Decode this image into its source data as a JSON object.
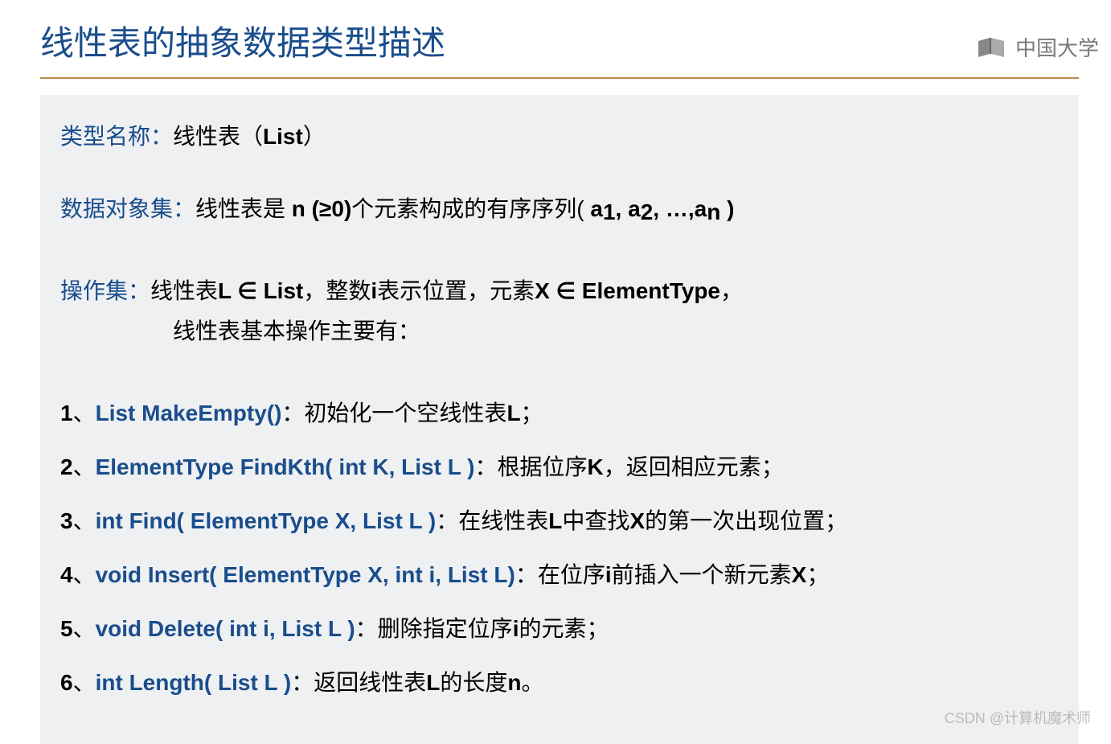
{
  "title": "线性表的抽象数据类型描述",
  "logo": {
    "text": "中国大学"
  },
  "typeName": {
    "label": "类型名称：",
    "value_prefix": "线性表（",
    "value_bold": "List",
    "value_suffix": "）"
  },
  "dataObject": {
    "label": "数据对象集：",
    "part1": "线性表是 ",
    "part2": "n (≥0)",
    "part3": "个元素构成的有序序列( ",
    "a1": "a",
    "sub1": "1",
    "comma1": ", ",
    "a2": "a",
    "sub2": "2",
    "comma2": ", …,",
    "an": "a",
    "subn": "n",
    "part4": " )"
  },
  "operationSet": {
    "label": "操作集：",
    "line1_p1": "线性表",
    "line1_p2": "L ∈ List",
    "line1_p3": "，整数",
    "line1_p4": "i",
    "line1_p5": "表示位置，元素",
    "line1_p6": "X ∈ ElementType",
    "line1_p7": "，",
    "line2": "线性表基本操作主要有："
  },
  "operations": [
    {
      "num": "1",
      "sep": "、",
      "code": "List MakeEmpty()",
      "desc_p1": "：初始化一个空线性表",
      "desc_b1": "L",
      "desc_p2": "；"
    },
    {
      "num": "2",
      "sep": "、",
      "code": "ElementType FindKth( int K, List L )",
      "desc_p1": "：根据位序",
      "desc_b1": "K",
      "desc_p2": "，返回相应元素；"
    },
    {
      "num": "3",
      "sep": "、",
      "code": "int Find( ElementType X, List L )",
      "desc_p1": "：在线性表",
      "desc_b1": "L",
      "desc_p2": "中查找",
      "desc_b2": "X",
      "desc_p3": "的第一次出现位置；"
    },
    {
      "num": "4",
      "sep": "、",
      "code": "void Insert( ElementType X, int i, List L)",
      "desc_p1": "：在位序",
      "desc_b1": "i",
      "desc_p2": "前插入一个新元素",
      "desc_b2": "X",
      "desc_p3": "；"
    },
    {
      "num": "5",
      "sep": "、",
      "code": "void Delete( int  i, List L )",
      "desc_p1": "：删除指定位序",
      "desc_b1": "i",
      "desc_p2": "的元素；"
    },
    {
      "num": "6",
      "sep": "、",
      "code": "int Length( List L )",
      "desc_p1": "：返回线性表",
      "desc_b1": "L",
      "desc_p2": "的长度",
      "desc_b2": "n",
      "desc_p3": "。"
    }
  ],
  "watermark": "CSDN @计算机魔术师"
}
